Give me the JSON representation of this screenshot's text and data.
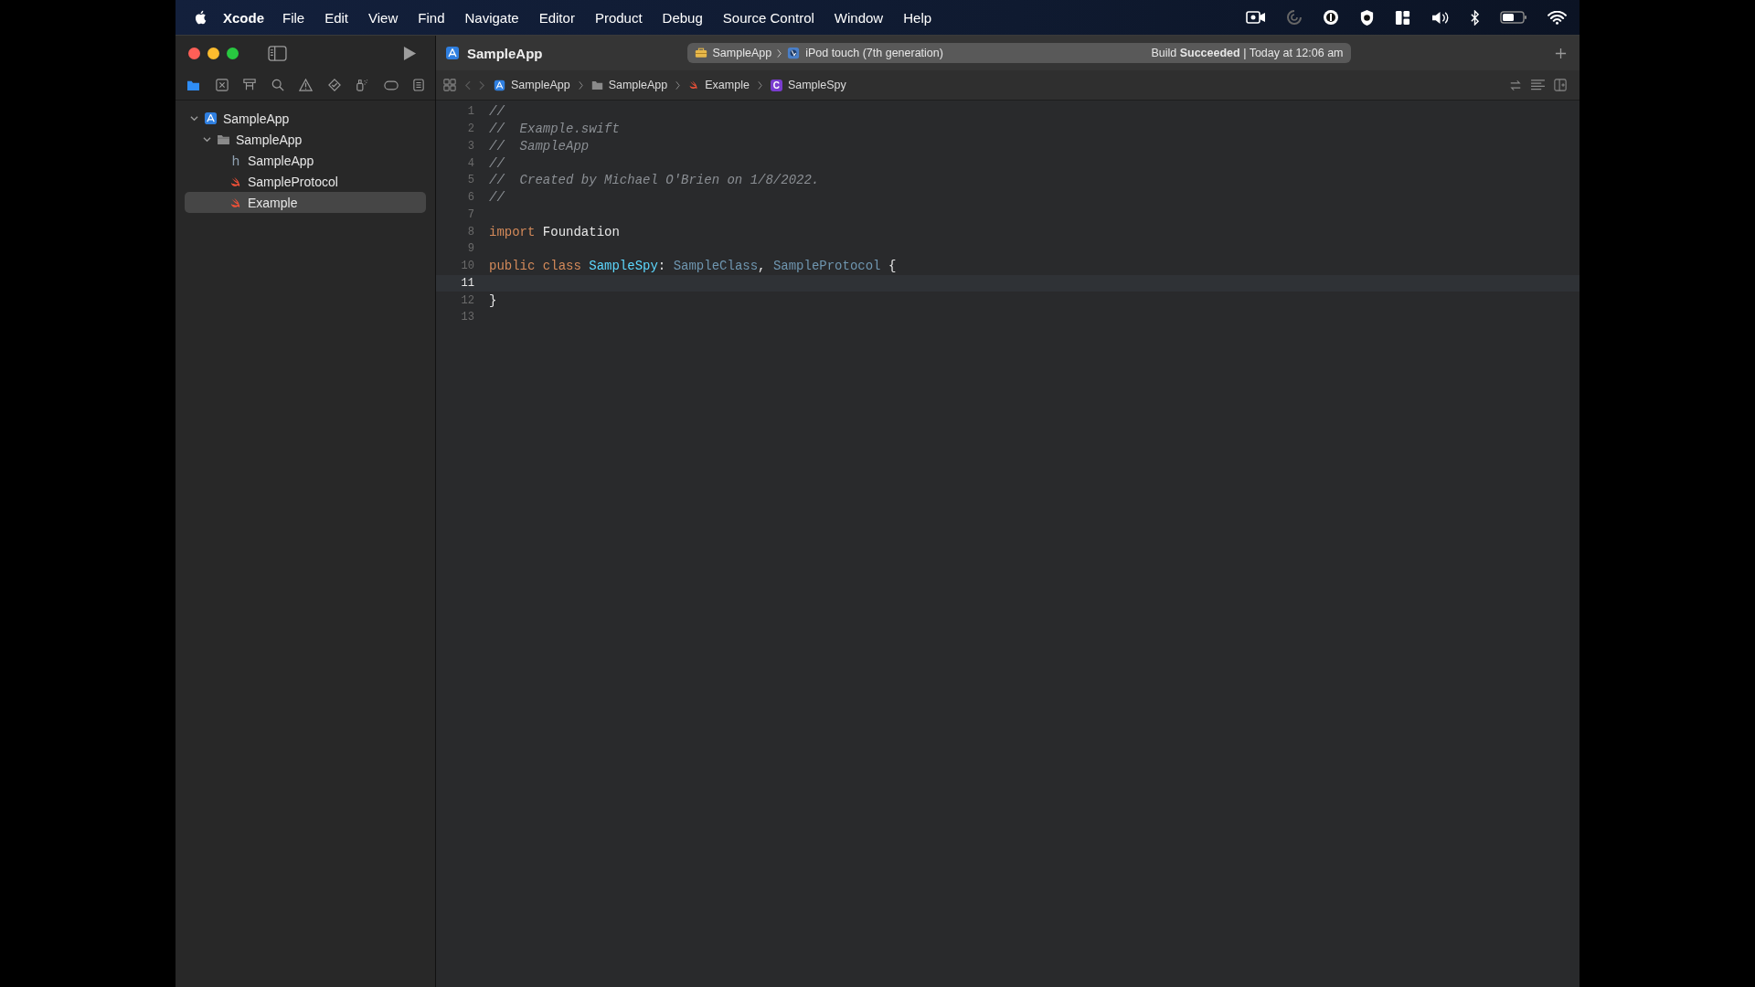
{
  "menu_bar": {
    "app": "Xcode",
    "menus": [
      "File",
      "Edit",
      "View",
      "Find",
      "Navigate",
      "Editor",
      "Product",
      "Debug",
      "Source Control",
      "Window",
      "Help"
    ]
  },
  "toolbar": {
    "title": "SampleApp",
    "scheme": "SampleApp",
    "device": "iPod touch (7th generation)",
    "status": "Build **Succeeded** | Today at 12:06 am"
  },
  "navigator_tabs": [
    {
      "selected": true
    },
    {
      "selected": false
    },
    {
      "selected": false
    },
    {
      "selected": false
    },
    {
      "selected": false
    },
    {
      "selected": false
    },
    {
      "selected": false
    },
    {
      "selected": false
    },
    {
      "selected": false
    }
  ],
  "sidebar": {
    "items": [
      {
        "label": "SampleApp",
        "kind": "project",
        "expanded": true,
        "selected": false,
        "children": [
          {
            "label": "SampleApp",
            "kind": "folder",
            "expanded": true,
            "selected": false,
            "children": [
              {
                "label": "SampleApp",
                "kind": "header",
                "badge": "h",
                "selected": false
              },
              {
                "label": "SampleProtocol",
                "kind": "swift",
                "selected": false
              },
              {
                "label": "Example",
                "kind": "swift",
                "selected": true
              }
            ]
          }
        ]
      }
    ]
  },
  "breadcrumbs": [
    {
      "label": "SampleApp",
      "kind": "project"
    },
    {
      "label": "SampleApp",
      "kind": "folder"
    },
    {
      "label": "Example",
      "kind": "swift"
    },
    {
      "label": "SampleSpy",
      "kind": "class",
      "badge": "C"
    }
  ],
  "editor": {
    "lines": [
      {
        "number": "1",
        "current": false,
        "tokens": [
          {
            "kind": "comment",
            "text": "//"
          }
        ]
      },
      {
        "number": "2",
        "current": false,
        "tokens": [
          {
            "kind": "comment",
            "text": "//  Example.swift"
          }
        ]
      },
      {
        "number": "3",
        "current": false,
        "tokens": [
          {
            "kind": "comment",
            "text": "//  SampleApp"
          }
        ]
      },
      {
        "number": "4",
        "current": false,
        "tokens": [
          {
            "kind": "comment",
            "text": "//"
          }
        ]
      },
      {
        "number": "5",
        "current": false,
        "tokens": [
          {
            "kind": "comment",
            "text": "//  Created by Michael O'Brien on 1/8/2022."
          }
        ]
      },
      {
        "number": "6",
        "current": false,
        "tokens": [
          {
            "kind": "comment",
            "text": "//"
          }
        ]
      },
      {
        "number": "7",
        "current": false
      },
      {
        "number": "8",
        "current": false,
        "tokens": [
          {
            "kind": "keyword",
            "text": "import"
          },
          {
            "kind": "plain",
            "text": "Foundation"
          }
        ]
      },
      {
        "number": "9",
        "current": false
      },
      {
        "number": "10",
        "current": false,
        "tokens": [
          {
            "kind": "keyword",
            "text": "public"
          },
          {
            "kind": "keyword",
            "text": "class"
          },
          {
            "kind": "declaration",
            "text": "SampleSpy"
          },
          {
            "kind": "plain",
            "text": ":"
          },
          {
            "kind": "type",
            "text": "SampleClass"
          },
          {
            "kind": "plain",
            "text": ","
          },
          {
            "kind": "type",
            "text": "SampleProtocol"
          },
          {
            "kind": "plain",
            "text": "{"
          }
        ]
      },
      {
        "number": "11",
        "current": true
      },
      {
        "number": "12",
        "current": false,
        "tokens": [
          {
            "kind": "plain",
            "text": "}"
          }
        ]
      },
      {
        "number": "13",
        "current": false
      }
    ]
  }
}
